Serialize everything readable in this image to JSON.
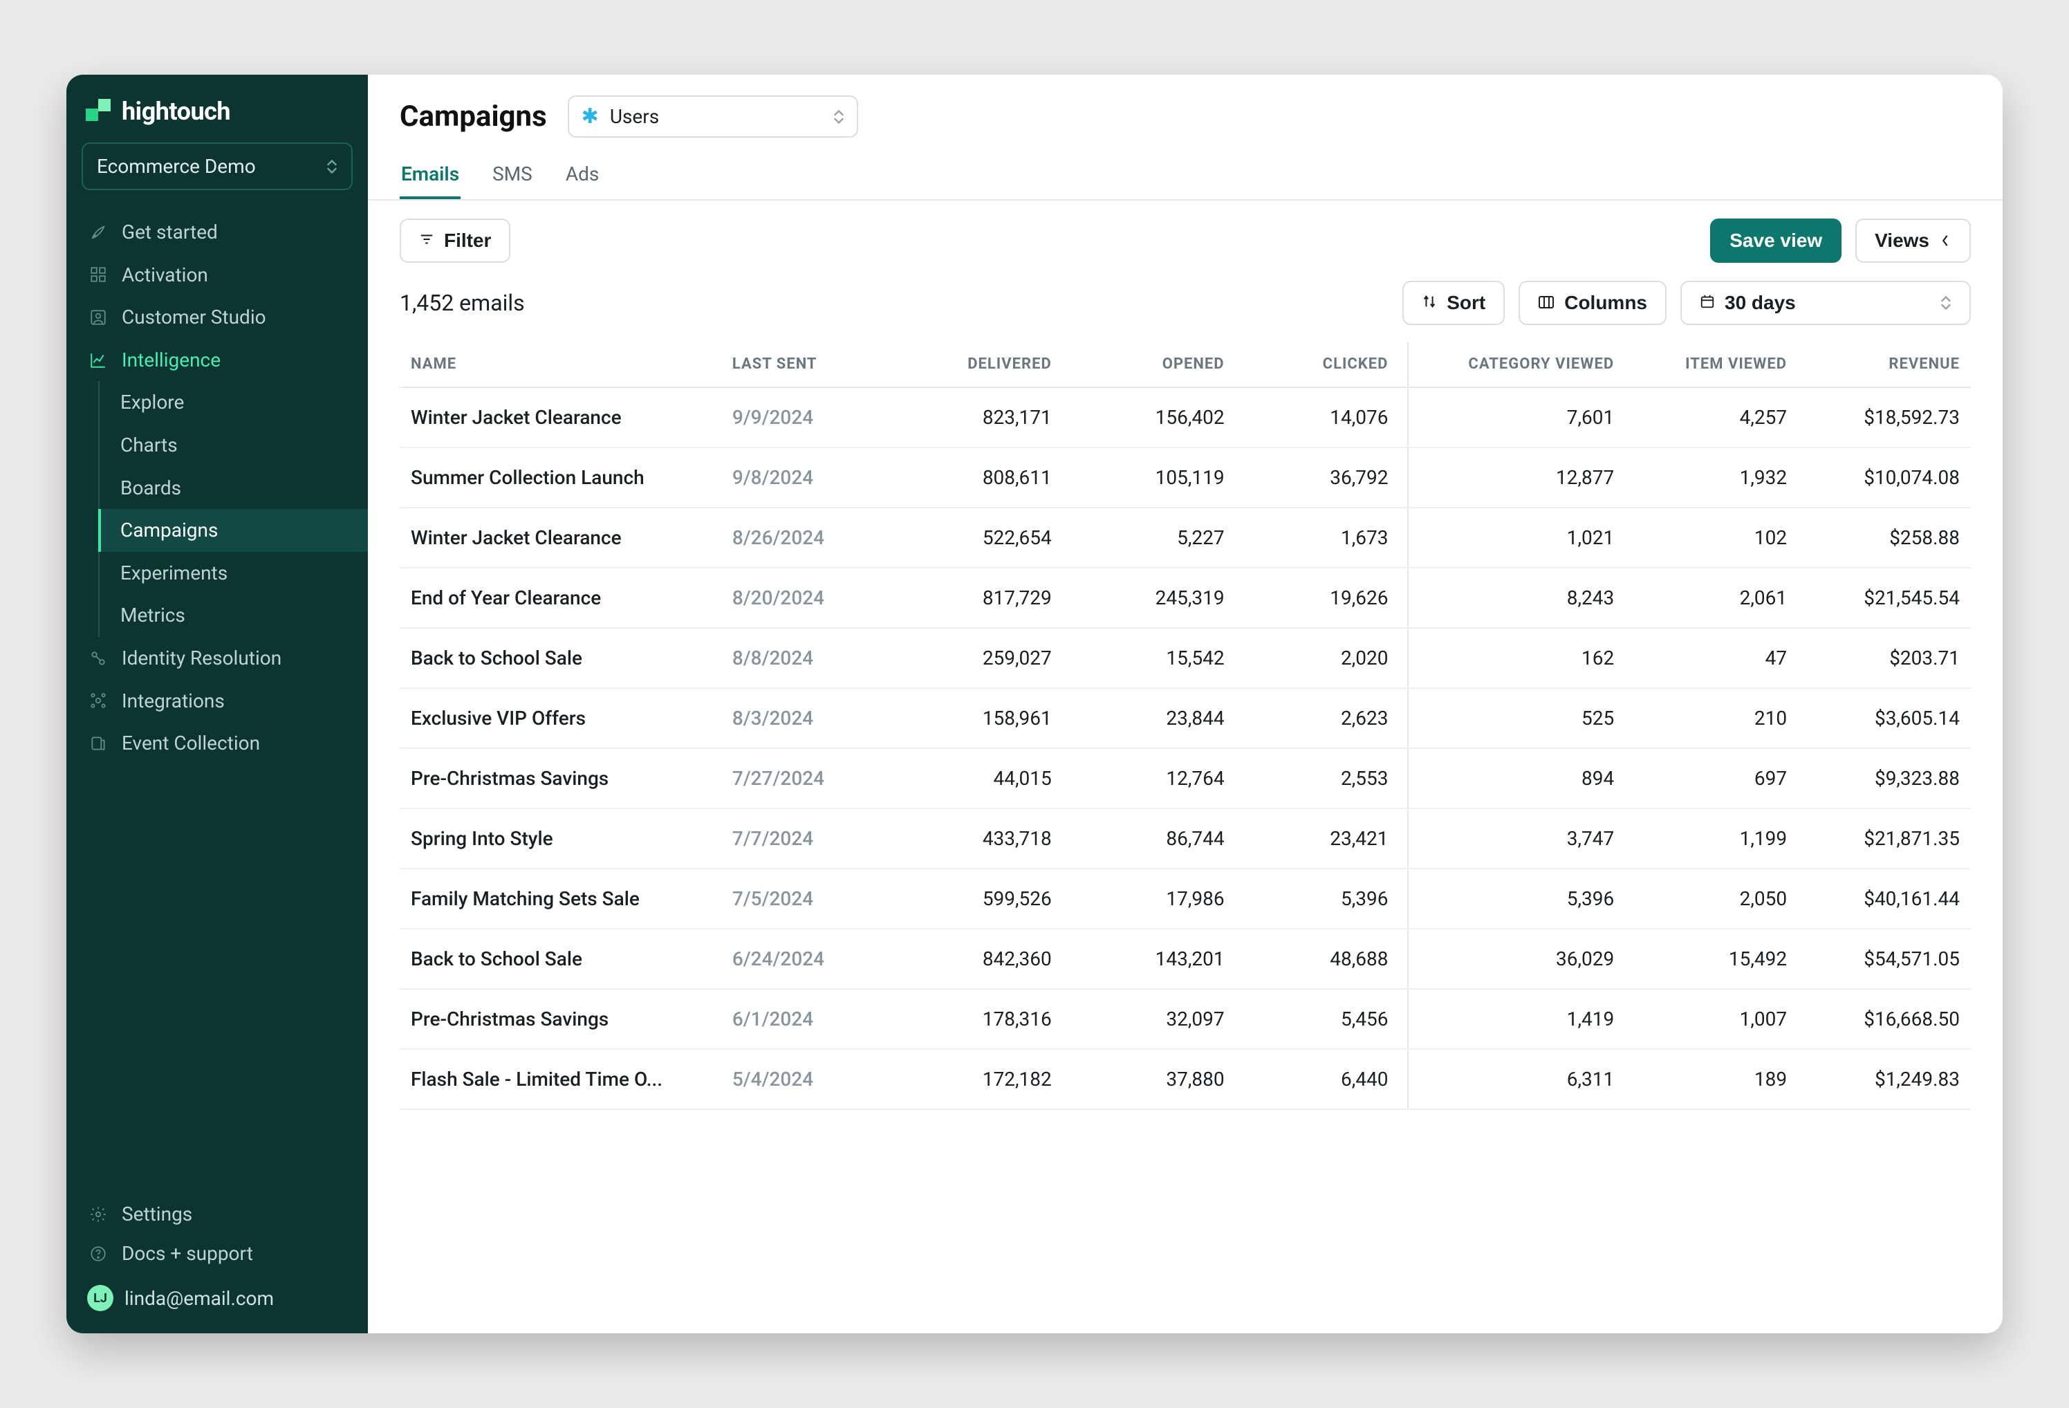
{
  "brand": "hightouch",
  "project_name": "Ecommerce Demo",
  "sidebar": {
    "items": [
      {
        "label": "Get started"
      },
      {
        "label": "Activation"
      },
      {
        "label": "Customer Studio"
      },
      {
        "label": "Intelligence",
        "active": true
      },
      {
        "label": "Identity Resolution"
      },
      {
        "label": "Integrations"
      },
      {
        "label": "Event Collection"
      }
    ],
    "intelligence_sub": [
      {
        "label": "Explore"
      },
      {
        "label": "Charts"
      },
      {
        "label": "Boards"
      },
      {
        "label": "Campaigns",
        "active": true
      },
      {
        "label": "Experiments"
      },
      {
        "label": "Metrics"
      }
    ],
    "bottom": [
      {
        "label": "Settings"
      },
      {
        "label": "Docs + support"
      }
    ],
    "user": {
      "initials": "LJ",
      "email": "linda@email.com"
    }
  },
  "header": {
    "title": "Campaigns",
    "parent_model": "Users",
    "tabs": [
      {
        "label": "Emails",
        "active": true
      },
      {
        "label": "SMS"
      },
      {
        "label": "Ads"
      }
    ]
  },
  "toolbar": {
    "filter_label": "Filter",
    "save_view_label": "Save view",
    "views_label": "Views"
  },
  "subtoolbar": {
    "count_text": "1,452 emails",
    "sort_label": "Sort",
    "columns_label": "Columns",
    "date_range": "30 days"
  },
  "table": {
    "headers": {
      "name": "NAME",
      "last_sent": "LAST SENT",
      "delivered": "DELIVERED",
      "opened": "OPENED",
      "clicked": "CLICKED",
      "category_viewed": "CATEGORY VIEWED",
      "item_viewed": "ITEM VIEWED",
      "revenue": "REVENUE"
    },
    "rows": [
      {
        "name": "Winter Jacket Clearance",
        "last_sent": "9/9/2024",
        "delivered": "823,171",
        "opened": "156,402",
        "clicked": "14,076",
        "category_viewed": "7,601",
        "item_viewed": "4,257",
        "revenue": "$18,592.73"
      },
      {
        "name": "Summer Collection Launch",
        "last_sent": "9/8/2024",
        "delivered": "808,611",
        "opened": "105,119",
        "clicked": "36,792",
        "category_viewed": "12,877",
        "item_viewed": "1,932",
        "revenue": "$10,074.08"
      },
      {
        "name": "Winter Jacket Clearance",
        "last_sent": "8/26/2024",
        "delivered": "522,654",
        "opened": "5,227",
        "clicked": "1,673",
        "category_viewed": "1,021",
        "item_viewed": "102",
        "revenue": "$258.88"
      },
      {
        "name": "End of Year Clearance",
        "last_sent": "8/20/2024",
        "delivered": "817,729",
        "opened": "245,319",
        "clicked": "19,626",
        "category_viewed": "8,243",
        "item_viewed": "2,061",
        "revenue": "$21,545.54"
      },
      {
        "name": "Back to School Sale",
        "last_sent": "8/8/2024",
        "delivered": "259,027",
        "opened": "15,542",
        "clicked": "2,020",
        "category_viewed": "162",
        "item_viewed": "47",
        "revenue": "$203.71"
      },
      {
        "name": "Exclusive VIP Offers",
        "last_sent": "8/3/2024",
        "delivered": "158,961",
        "opened": "23,844",
        "clicked": "2,623",
        "category_viewed": "525",
        "item_viewed": "210",
        "revenue": "$3,605.14"
      },
      {
        "name": "Pre-Christmas Savings",
        "last_sent": "7/27/2024",
        "delivered": "44,015",
        "opened": "12,764",
        "clicked": "2,553",
        "category_viewed": "894",
        "item_viewed": "697",
        "revenue": "$9,323.88"
      },
      {
        "name": "Spring Into Style",
        "last_sent": "7/7/2024",
        "delivered": "433,718",
        "opened": "86,744",
        "clicked": "23,421",
        "category_viewed": "3,747",
        "item_viewed": "1,199",
        "revenue": "$21,871.35"
      },
      {
        "name": "Family Matching Sets Sale",
        "last_sent": "7/5/2024",
        "delivered": "599,526",
        "opened": "17,986",
        "clicked": "5,396",
        "category_viewed": "5,396",
        "item_viewed": "2,050",
        "revenue": "$40,161.44"
      },
      {
        "name": "Back to School Sale",
        "last_sent": "6/24/2024",
        "delivered": "842,360",
        "opened": "143,201",
        "clicked": "48,688",
        "category_viewed": "36,029",
        "item_viewed": "15,492",
        "revenue": "$54,571.05"
      },
      {
        "name": "Pre-Christmas Savings",
        "last_sent": "6/1/2024",
        "delivered": "178,316",
        "opened": "32,097",
        "clicked": "5,456",
        "category_viewed": "1,419",
        "item_viewed": "1,007",
        "revenue": "$16,668.50"
      },
      {
        "name": "Flash Sale - Limited Time O...",
        "last_sent": "5/4/2024",
        "delivered": "172,182",
        "opened": "37,880",
        "clicked": "6,440",
        "category_viewed": "6,311",
        "item_viewed": "189",
        "revenue": "$1,249.83"
      }
    ]
  }
}
